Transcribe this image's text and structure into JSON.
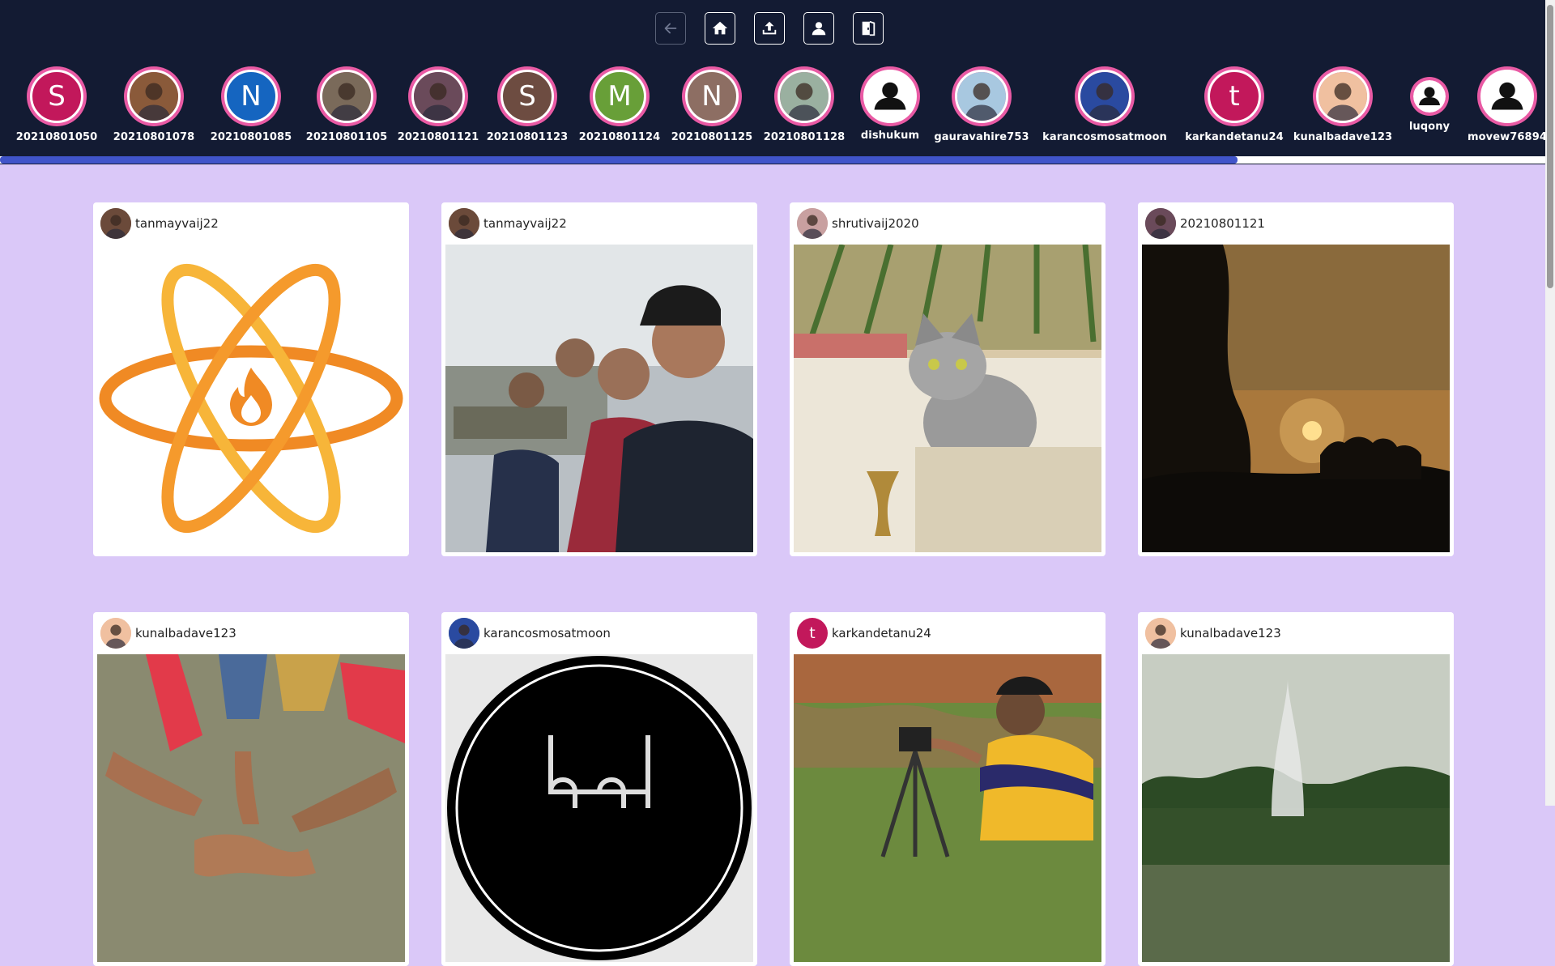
{
  "toolbar": {
    "buttons": [
      {
        "name": "back-button",
        "icon": "arrow-left-icon"
      },
      {
        "name": "home-button",
        "icon": "home-icon"
      },
      {
        "name": "upload-button",
        "icon": "upload-icon"
      },
      {
        "name": "profile-button",
        "icon": "user-icon"
      },
      {
        "name": "logout-button",
        "icon": "door-exit-icon"
      }
    ]
  },
  "stories": [
    {
      "username": "20210801050",
      "initial": "S",
      "color": "#c2185b",
      "type": "letter"
    },
    {
      "username": "20210801078",
      "initial": "",
      "color": "#8a5a3a",
      "type": "photo"
    },
    {
      "username": "20210801085",
      "initial": "N",
      "color": "#1565c0",
      "type": "letter"
    },
    {
      "username": "20210801105",
      "initial": "",
      "color": "#7a6a5a",
      "type": "photo"
    },
    {
      "username": "20210801121",
      "initial": "",
      "color": "#6a4a5a",
      "type": "photo"
    },
    {
      "username": "20210801123",
      "initial": "S",
      "color": "#6d4c41",
      "type": "letter"
    },
    {
      "username": "20210801124",
      "initial": "M",
      "color": "#689f38",
      "type": "letter"
    },
    {
      "username": "20210801125",
      "initial": "N",
      "color": "#8d6e63",
      "type": "letter"
    },
    {
      "username": "20210801128",
      "initial": "",
      "color": "#9ab0a0",
      "type": "photo"
    },
    {
      "username": "dishukum",
      "initial": "",
      "color": "#ffffff",
      "type": "default"
    },
    {
      "username": "gauravahire753",
      "initial": "",
      "color": "#a8c8e0",
      "type": "photo"
    },
    {
      "username": "karancosmosatmoon",
      "initial": "",
      "color": "#2a4aa0",
      "type": "photo"
    },
    {
      "username": "karkandetanu24",
      "initial": "t",
      "color": "#c2185b",
      "type": "letter"
    },
    {
      "username": "kunalbadave123",
      "initial": "",
      "color": "#f0c0a0",
      "type": "photo"
    },
    {
      "username": "luqony",
      "initial": "",
      "color": "#ffffff",
      "type": "default-small"
    },
    {
      "username": "movew76894",
      "initial": "",
      "color": "#ffffff",
      "type": "default"
    }
  ],
  "posts": [
    {
      "username": "tanmayvaij22",
      "avatar_initial": "",
      "avatar_color": "#6b4a3a",
      "image": "atom-logo"
    },
    {
      "username": "tanmayvaij22",
      "avatar_initial": "",
      "avatar_color": "#6b4a3a",
      "image": "group-selfie-photo"
    },
    {
      "username": "shrutivaij2020",
      "avatar_initial": "",
      "avatar_color": "#c8a0a0",
      "image": "cat-photo"
    },
    {
      "username": "20210801121",
      "avatar_initial": "",
      "avatar_color": "#6a4a5a",
      "image": "sunset-photo"
    },
    {
      "username": "kunalbadave123",
      "avatar_initial": "",
      "avatar_color": "#f0c0a0",
      "image": "hands-circle-photo"
    },
    {
      "username": "karancosmosatmoon",
      "avatar_initial": "",
      "avatar_color": "#2a4aa0",
      "image": "dark-logo"
    },
    {
      "username": "karkandetanu24",
      "avatar_initial": "t",
      "avatar_color": "#c2185b",
      "image": "camera-boy-photo"
    },
    {
      "username": "kunalbadave123",
      "avatar_initial": "",
      "avatar_color": "#f0c0a0",
      "image": "fountain-photo"
    }
  ],
  "colors": {
    "header_bg": "#131b33",
    "page_bg": "#dac8f8",
    "story_ring": "#e95aa4",
    "scroll_thumb": "#4054c9"
  }
}
